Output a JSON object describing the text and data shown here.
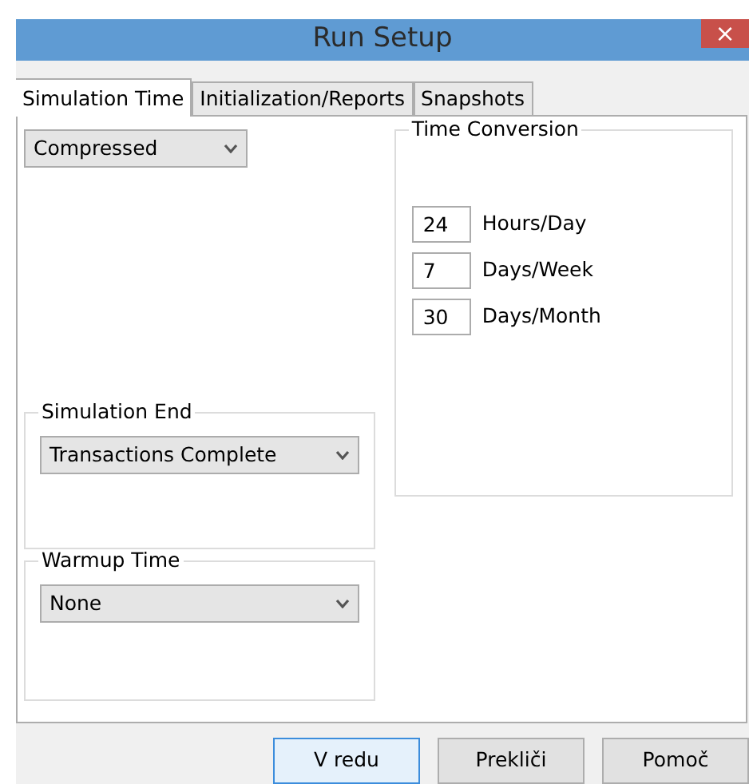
{
  "window": {
    "title": "Run Setup",
    "close": "×"
  },
  "tabs": [
    {
      "label": "Simulation Time",
      "selected": true
    },
    {
      "label": "Initialization/Reports",
      "selected": false
    },
    {
      "label": "Snapshots",
      "selected": false
    }
  ],
  "time_mode": {
    "value": "Compressed"
  },
  "simulation_end": {
    "title": "Simulation End",
    "value": "Transactions Complete"
  },
  "warmup_time": {
    "title": "Warmup Time",
    "value": "None"
  },
  "time_conversion": {
    "title": "Time Conversion",
    "rows": [
      {
        "value": "24",
        "label": "Hours/Day"
      },
      {
        "value": "7",
        "label": "Days/Week"
      },
      {
        "value": "30",
        "label": "Days/Month"
      }
    ]
  },
  "buttons": [
    {
      "label": "V redu",
      "focused": true
    },
    {
      "label": "Prekliči",
      "focused": false
    },
    {
      "label": "Pomoč",
      "focused": false
    }
  ]
}
